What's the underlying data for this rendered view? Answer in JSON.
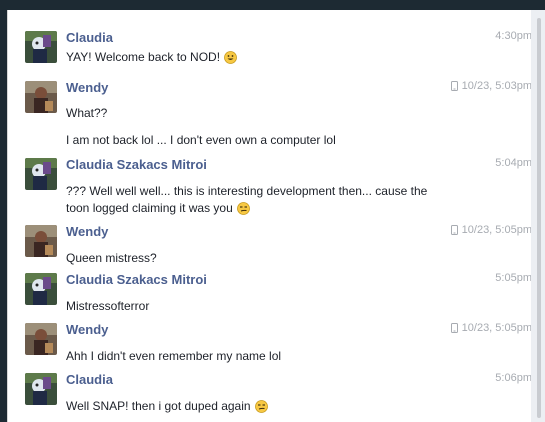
{
  "messages": [
    {
      "sender": "Claudia",
      "avatar": "claudia-avatar",
      "time": "4:30pm",
      "phone": false,
      "lines": [
        "YAY! Welcome back to NOD!"
      ],
      "emoji": [
        "grin-emoji"
      ]
    },
    {
      "sender": "Wendy",
      "avatar": "wendy-avatar",
      "time": "10/23, 5:03pm",
      "phone": true,
      "lines": [
        "What??",
        "I am not back lol ... I don't even own a computer lol"
      ],
      "emoji": []
    },
    {
      "sender": "Claudia Szakacs Mitroi",
      "avatar": "claudia-avatar",
      "time": "5:04pm",
      "phone": false,
      "lines": [
        "??? Well well well... this is interesting development then... cause the",
        "toon logged claiming it was you"
      ],
      "emoji": [
        "smirk-emoji"
      ]
    },
    {
      "sender": "Wendy",
      "avatar": "wendy-avatar",
      "time": "10/23, 5:05pm",
      "phone": true,
      "lines": [
        "Queen mistress?"
      ],
      "emoji": []
    },
    {
      "sender": "Claudia Szakacs Mitroi",
      "avatar": "claudia-avatar",
      "time": "5:05pm",
      "phone": false,
      "lines": [
        "Mistressofterror"
      ],
      "emoji": []
    },
    {
      "sender": "Wendy",
      "avatar": "wendy-avatar",
      "time": "10/23, 5:05pm",
      "phone": true,
      "lines": [
        "Ahh I didn't even remember my name lol"
      ],
      "emoji": []
    },
    {
      "sender": "Claudia",
      "avatar": "claudia-avatar",
      "time": "5:06pm",
      "phone": false,
      "lines": [
        "Well SNAP! then i got duped again"
      ],
      "emoji": [
        "smirk-emoji"
      ]
    }
  ],
  "colors": {
    "name": "#4b5f8f",
    "text": "#1d2129",
    "time": "#a7abb1",
    "emoji": "#f7c843"
  }
}
